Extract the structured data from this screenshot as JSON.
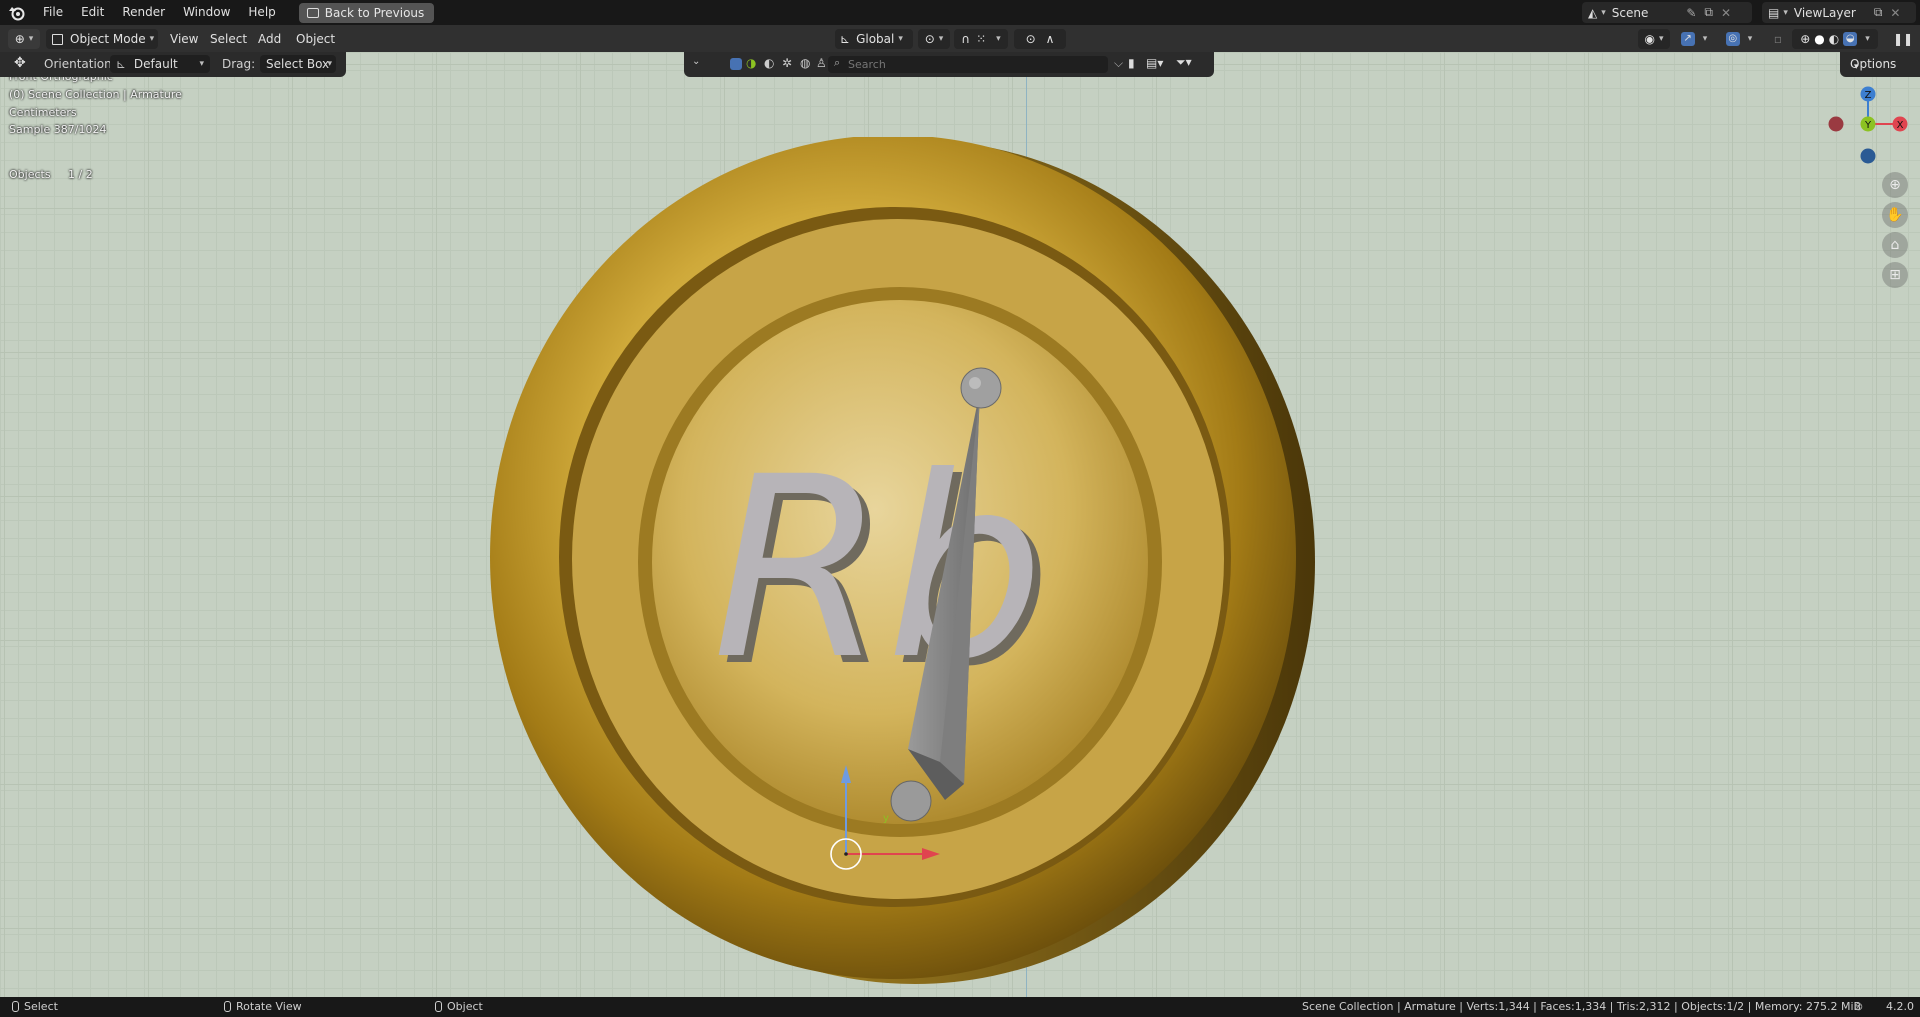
{
  "menubar": {
    "items": [
      "File",
      "Edit",
      "Render",
      "Window",
      "Help"
    ],
    "back_button": "Back to Previous",
    "scene_label": "Scene",
    "viewlayer_label": "ViewLayer"
  },
  "header": {
    "mode": "Object Mode",
    "menus": [
      "View",
      "Select",
      "Add",
      "Object"
    ],
    "transform_orientation": "Global",
    "options": "Options"
  },
  "tool_settings": {
    "orientation_label": "Orientation:",
    "orientation_value": "Default",
    "drag_label": "Drag:",
    "drag_value": "Select Box"
  },
  "search": {
    "placeholder": "Search"
  },
  "viewport_info": {
    "view_name": "Front Orthographic",
    "collection": "(0) Scene Collection | Armature",
    "units": "Centimeters",
    "sample": "Sample 387/1024",
    "objects_label": "Objects",
    "objects_value": "1 / 2"
  },
  "gizmo": {
    "z": "Z",
    "y": "Y",
    "x": "X"
  },
  "model": {
    "coin_letters": "Rb"
  },
  "statusbar": {
    "select": "Select",
    "rotate": "Rotate View",
    "object": "Object",
    "stats": "Scene Collection | Armature | Verts:1,344 | Faces:1,334 | Tris:2,312 | Objects:1/2 | Memory: 275.2 MiB",
    "version": "4.2.0"
  },
  "colors": {
    "accent_blue": "#4772b3",
    "gizmo_x": "#e0444f",
    "gizmo_y": "#8cc222",
    "gizmo_z": "#3d7fd1",
    "gold": "#c9a227",
    "viewport_bg": "#c5d0c2"
  }
}
